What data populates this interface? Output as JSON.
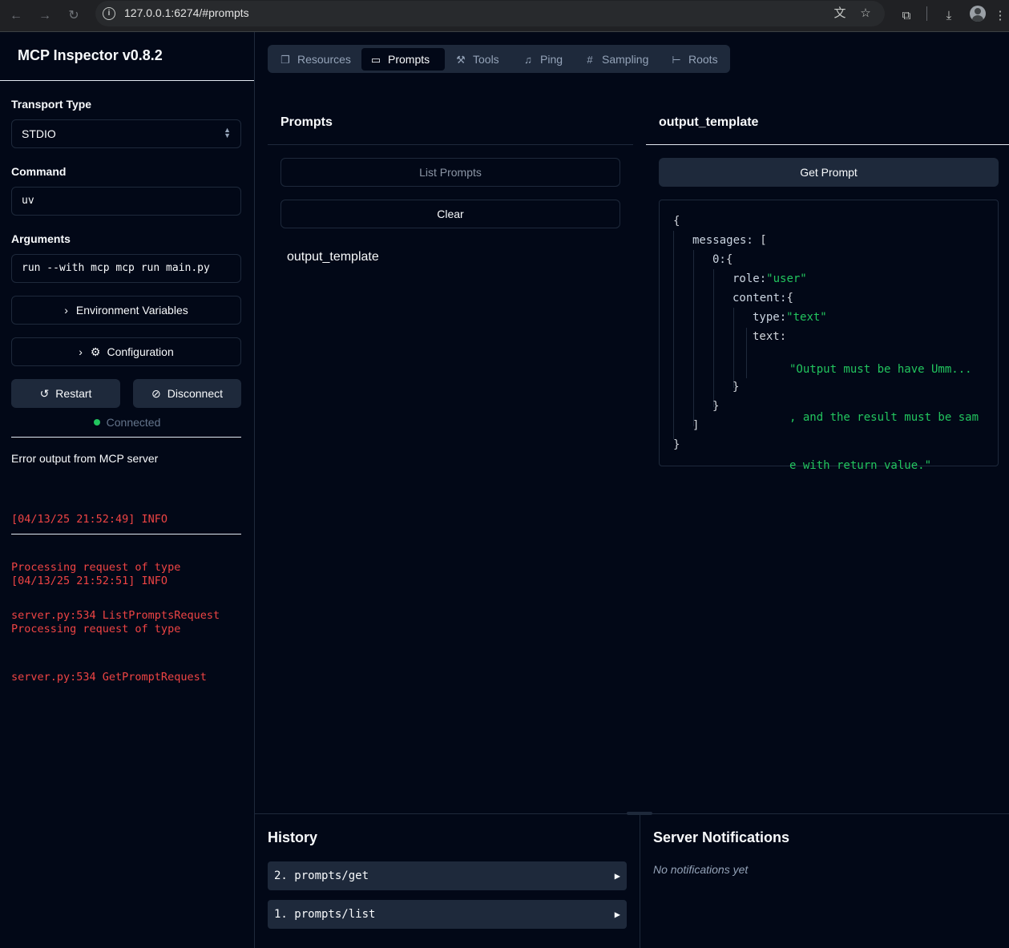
{
  "browser": {
    "url": "127.0.0.1:6274/#prompts"
  },
  "sidebar": {
    "title": "MCP Inspector v0.8.2",
    "transport_label": "Transport Type",
    "transport_value": "STDIO",
    "command_label": "Command",
    "command_value": "uv",
    "arguments_label": "Arguments",
    "arguments_value": "run --with mcp mcp run main.py",
    "env_button": "Environment Variables",
    "config_button": "Configuration",
    "restart_button": "Restart",
    "disconnect_button": "Disconnect",
    "status": "Connected",
    "status_color": "#22c55e",
    "error_heading": "Error output from MCP server",
    "logs": [
      {
        "lines": [
          "[04/13/25 21:52:49] INFO",
          "Processing request of type",
          "server.py:534 ListPromptsRequest"
        ]
      },
      {
        "lines": [
          "[04/13/25 21:52:51] INFO",
          "Processing request of type",
          "server.py:534 GetPromptRequest"
        ]
      }
    ]
  },
  "tabs": [
    {
      "label": "Resources",
      "icon": "files-icon"
    },
    {
      "label": "Prompts",
      "icon": "message-square-icon",
      "active": true
    },
    {
      "label": "Tools",
      "icon": "hammer-icon"
    },
    {
      "label": "Ping",
      "icon": "bell-icon"
    },
    {
      "label": "Sampling",
      "icon": "hash-icon"
    },
    {
      "label": "Roots",
      "icon": "folder-tree-icon"
    }
  ],
  "prompts_panel": {
    "title": "Prompts",
    "list_button": "List Prompts",
    "clear_button": "Clear",
    "items": [
      "output_template"
    ]
  },
  "detail_panel": {
    "title": "output_template",
    "get_button": "Get Prompt",
    "json": {
      "open": "{",
      "messages_key": "messages:",
      "messages_open": "[",
      "index_key": "0:",
      "index_open": "{",
      "role_key": "role:",
      "role_value": "\"user\"",
      "content_key": "content:",
      "content_open": "{",
      "type_key": "type:",
      "type_value": "\"text\"",
      "text_key": "text:",
      "text_value_lines": [
        "\"Output must be have Umm...",
        ", and the result must be sam",
        "e with return value.\""
      ],
      "close_content": "}",
      "close_index": "}",
      "close_messages": "]",
      "close": "}"
    },
    "string_color": "#22c55e"
  },
  "history": {
    "title": "History",
    "items": [
      "2. prompts/get",
      "1. prompts/list"
    ]
  },
  "notifications": {
    "title": "Server Notifications",
    "empty": "No notifications yet"
  }
}
